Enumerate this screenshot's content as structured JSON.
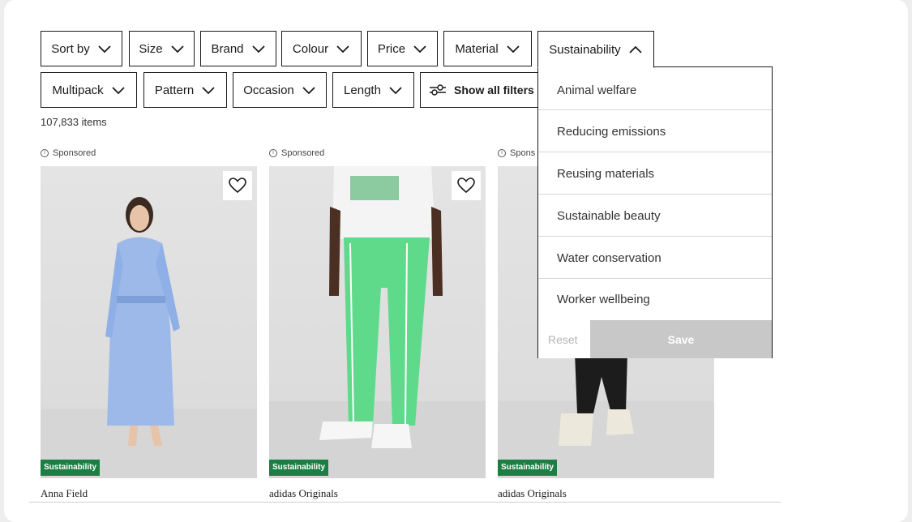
{
  "filters": {
    "row1": [
      {
        "label": "Sort by"
      },
      {
        "label": "Size"
      },
      {
        "label": "Brand"
      },
      {
        "label": "Colour"
      },
      {
        "label": "Price"
      },
      {
        "label": "Material"
      },
      {
        "label": "Sustainability",
        "open": true
      }
    ],
    "row2": [
      {
        "label": "Multipack"
      },
      {
        "label": "Pattern"
      },
      {
        "label": "Occasion"
      },
      {
        "label": "Length"
      }
    ],
    "show_all": "Show all filters"
  },
  "results": {
    "count": "107,833 items"
  },
  "products": [
    {
      "sponsored": "Sponsored",
      "badge": "Sustainability",
      "brand": "Anna Field",
      "wishlist_icon": "heart-outline-icon"
    },
    {
      "sponsored": "Sponsored",
      "badge": "Sustainability",
      "brand": "adidas Originals",
      "wishlist_icon": "heart-outline-icon"
    },
    {
      "sponsored": "Spons",
      "badge": "Sustainability",
      "brand": "adidas Originals",
      "wishlist_icon": "heart-outline-icon"
    }
  ],
  "dropdown": {
    "options": [
      "Animal welfare",
      "Reducing emissions",
      "Reusing materials",
      "Sustainable beauty",
      "Water conservation",
      "Worker wellbeing"
    ],
    "reset": "Reset",
    "save": "Save"
  },
  "colors": {
    "badge": "#1c7e43",
    "save_disabled": "#c8c8c8",
    "border": "#1a1a1a"
  }
}
